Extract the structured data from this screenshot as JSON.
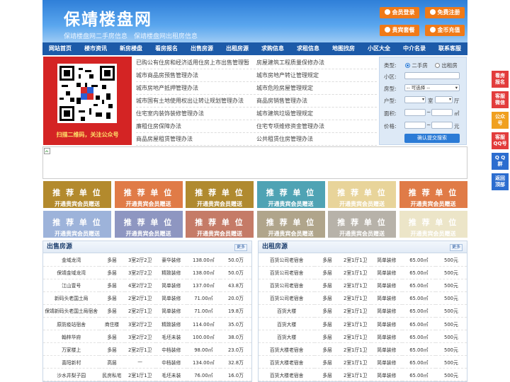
{
  "site": {
    "title": "保靖楼盘网",
    "subtitle": "保靖楼盘网二手房信息　保靖楼盘网出租房信息"
  },
  "header_buttons": [
    "会员登录",
    "免费注册",
    "贵宾套餐",
    "金币充值"
  ],
  "nav": [
    "网站首页",
    "楼市资讯",
    "新房楼盘",
    "看房报名",
    "出售房源",
    "出租房源",
    "求购信息",
    "求租信息",
    "地图找房",
    "小区大全",
    "中介名录",
    "联系客服"
  ],
  "qr_caption": "扫描二维码，关注公众号",
  "links": [
    [
      "已购公有住房和经济适用住房上市出售管理暂",
      "房屋建筑工程质量保修办法"
    ],
    [
      "城市商品房预售管理办法",
      "城市房地产转让管理规定"
    ],
    [
      "城市房地产抵押管理办法",
      "城市危险房屋管理规定"
    ],
    [
      "城市国有土地使用权出让转让规划管理办法",
      "商品房销售管理办法"
    ],
    [
      "住宅室内装饰装修管理办法",
      "城市建筑垃圾管理规定"
    ],
    [
      "廉租住房保障办法",
      "住宅专项维修资金管理办法"
    ],
    [
      "商品房屋租赁管理办法",
      "公共租赁住房管理办法"
    ]
  ],
  "search": {
    "type_label": "类型:",
    "opt_sale": "二手房",
    "opt_rent": "出租房",
    "district_label": "小区:",
    "house_label": "房型:",
    "house_select": "-- 可选择 --",
    "layout_label": "户型:",
    "room_unit": "室",
    "hall_unit": "厅",
    "area_label": "面积:",
    "area_unit": "㎡",
    "price_label": "价格:",
    "price_unit": "元",
    "button": "确认提交搜索"
  },
  "tiles": {
    "title": "推 荐 单 位",
    "sub": "开通贵宾会员赠送",
    "colors": [
      "#b38a2d",
      "#e07b47",
      "#b08a2f",
      "#4fa3b4",
      "#e8d49a",
      "#e07b47",
      "#9db3da",
      "#8e96c1",
      "#c57b67",
      "#b0a58b",
      "#b7b2a9",
      "#ece5c8"
    ]
  },
  "sale": {
    "title": "出售房源",
    "more": "更多",
    "rows": [
      [
        "金域龙湾",
        "多层",
        "3室2厅2卫",
        "豪华装修",
        "138.00㎡",
        "50.0万"
      ],
      [
        "保靖金域龙湾",
        "多层",
        "3室2厅2卫",
        "精致装修",
        "138.00㎡",
        "50.0万"
      ],
      [
        "江山壹号",
        "多层",
        "4室2厅2卫",
        "简单装修",
        "137.00㎡",
        "43.8万"
      ],
      [
        "新码头老国土局",
        "多层",
        "2室2厅1卫",
        "简单装修",
        "71.00㎡",
        "20.0万"
      ],
      [
        "保靖新码头老国土局宿舍",
        "多层",
        "2室2厅1卫",
        "简单装修",
        "71.00㎡",
        "19.8万"
      ],
      [
        "原防疫站宿舍",
        "商住楼",
        "3室2厅2卫",
        "精致装修",
        "114.00㎡",
        "35.0万"
      ],
      [
        "翰林华府",
        "多层",
        "3室2厅2卫",
        "毛坯未装",
        "100.00㎡",
        "38.0万"
      ],
      [
        "万家楼上",
        "多层",
        "2室2厅1卫",
        "中档装修",
        "98.00㎡",
        "23.0万"
      ],
      [
        "喜阳新村",
        "高层",
        "—",
        "中档装修",
        "134.00㎡",
        "32.8万"
      ],
      [
        "沙水井梨子园",
        "民房私宅",
        "2室1厅1卫",
        "毛坯未装",
        "76.00㎡",
        "16.0万"
      ]
    ]
  },
  "rent": {
    "title": "出租房源",
    "more": "更多",
    "rows": [
      [
        "百货公司老宿舍",
        "多层",
        "2室1厅1卫",
        "简单装修",
        "65.00㎡",
        "500元"
      ],
      [
        "百货公司老宿舍",
        "多层",
        "2室1厅1卫",
        "简单装修",
        "65.00㎡",
        "500元"
      ],
      [
        "百货公司老宿舍",
        "多层",
        "2室1厅1卫",
        "简单装修",
        "65.00㎡",
        "500元"
      ],
      [
        "百货公司老宿舍",
        "多层",
        "2室1厅1卫",
        "简单装修",
        "65.00㎡",
        "500元"
      ],
      [
        "百货大楼",
        "多层",
        "2室1厅1卫",
        "简单装修",
        "65.00㎡",
        "500元"
      ],
      [
        "百货大楼",
        "多层",
        "2室1厅1卫",
        "简单装修",
        "65.00㎡",
        "500元"
      ],
      [
        "百货大楼",
        "多层",
        "2室1厅1卫",
        "简单装修",
        "65.00㎡",
        "500元"
      ],
      [
        "百货大楼老宿舍",
        "多层",
        "2室1厅1卫",
        "简单装修",
        "65.00㎡",
        "500元"
      ],
      [
        "百货大楼老宿舍",
        "多层",
        "2室1厅1卫",
        "简单装修",
        "65.00㎡",
        "500元"
      ],
      [
        "百货大楼老宿舍",
        "多层",
        "2室1厅1卫",
        "简单装修",
        "65.00㎡",
        "500元"
      ]
    ]
  },
  "sidebar": [
    "看房\n报名",
    "客服\n微信",
    "公众\n号",
    "客服\nQQ号",
    "Q Q\n群",
    "返回\n顶部"
  ]
}
